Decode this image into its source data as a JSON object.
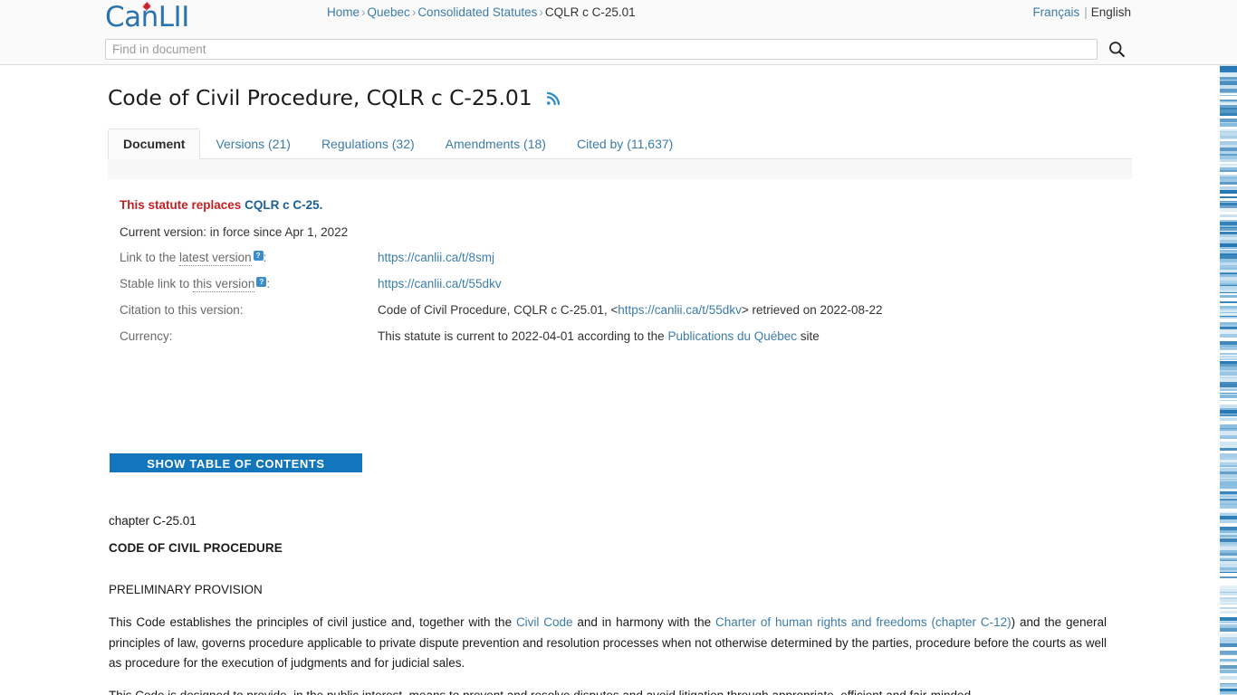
{
  "header": {
    "logo_text": "CanLII",
    "logo_icon": "maple-leaf-icon",
    "breadcrumb": [
      {
        "label": "Home",
        "link": true
      },
      {
        "label": "Quebec",
        "link": true
      },
      {
        "label": "Consolidated Statutes",
        "link": true
      },
      {
        "label": "CQLR c C-25.01",
        "link": false
      }
    ],
    "breadcrumb_separator": "›",
    "language": {
      "french_label": "Français",
      "divider": "|",
      "english_label": "English",
      "selected": "English"
    },
    "search": {
      "placeholder": "Find in document",
      "value": "",
      "button_icon": "search-icon"
    }
  },
  "document": {
    "title": "Code of Civil Procedure, CQLR c C-25.01",
    "rss_icon": "rss-feed-icon"
  },
  "tabs": [
    {
      "label": "Document",
      "active": true
    },
    {
      "label": "Versions (21)",
      "active": false
    },
    {
      "label": "Regulations (32)",
      "active": false
    },
    {
      "label": "Amendments (18)",
      "active": false
    },
    {
      "label": "Cited by (11,637)",
      "active": false
    }
  ],
  "meta": {
    "replaces_prefix": "This statute replaces",
    "replaces_link": "CQLR c C-25.",
    "current_version": "Current version: in force since Apr 1, 2022",
    "rows": [
      {
        "label_prefix": "Link to the ",
        "label_dotted": "latest version",
        "help_badge": "?",
        "label_suffix": ":",
        "value": "https://canlii.ca/t/8smj",
        "value_is_link": true
      },
      {
        "label_prefix": "Stable link to ",
        "label_dotted": "this version",
        "help_badge": "?",
        "label_suffix": ":",
        "value": "https://canlii.ca/t/55dkv",
        "value_is_link": true
      }
    ],
    "citation": {
      "label": "Citation to this version:",
      "text_before": "Code of Civil Procedure, CQLR c C-25.01, <",
      "link": "https://canlii.ca/t/55dkv",
      "text_after": "> retrieved on 2022-08-22"
    },
    "currency": {
      "label": "Currency:",
      "text_before": "This statute is current to 2022-04-01 according to the ",
      "link": "Publications du Québec",
      "text_after": " site"
    }
  },
  "toc_button": {
    "label": "SHOW TABLE OF CONTENTS",
    "color": "#1176bc"
  },
  "body": {
    "chapter_line": "chapter  C-25.01",
    "doc_title": "CODE OF CIVIL PROCEDURE",
    "preliminary_heading": "PRELIMINARY PROVISION",
    "paragraph1_part1": "This Code establishes the principles of civil justice and, together with the ",
    "paragraph1_link1": "Civil Code",
    "paragraph1_part2": " and in harmony with the ",
    "paragraph1_link2": "Charter of human rights and freedoms (chapter C-12)",
    "paragraph1_part3": ") and the general principles of law, governs procedure applicable to private dispute prevention and resolution processes when not otherwise determined by the parties, procedure before the courts as well as procedure for the execution of judgments and for judicial sales.",
    "paragraph2_partial": "This Code is designed to provide, in the public interest, means to prevent and resolve disputes and avoid litigation through appropriate, efficient and fair-minded"
  },
  "minimap": {
    "name": "document-minimap-scrollbar",
    "accent": "#2e8bc9"
  },
  "colors": {
    "link": "#3c7ca8",
    "alert_red": "#c32025",
    "brand_blue": "#1176bc",
    "header_bg": "#fafafa"
  }
}
